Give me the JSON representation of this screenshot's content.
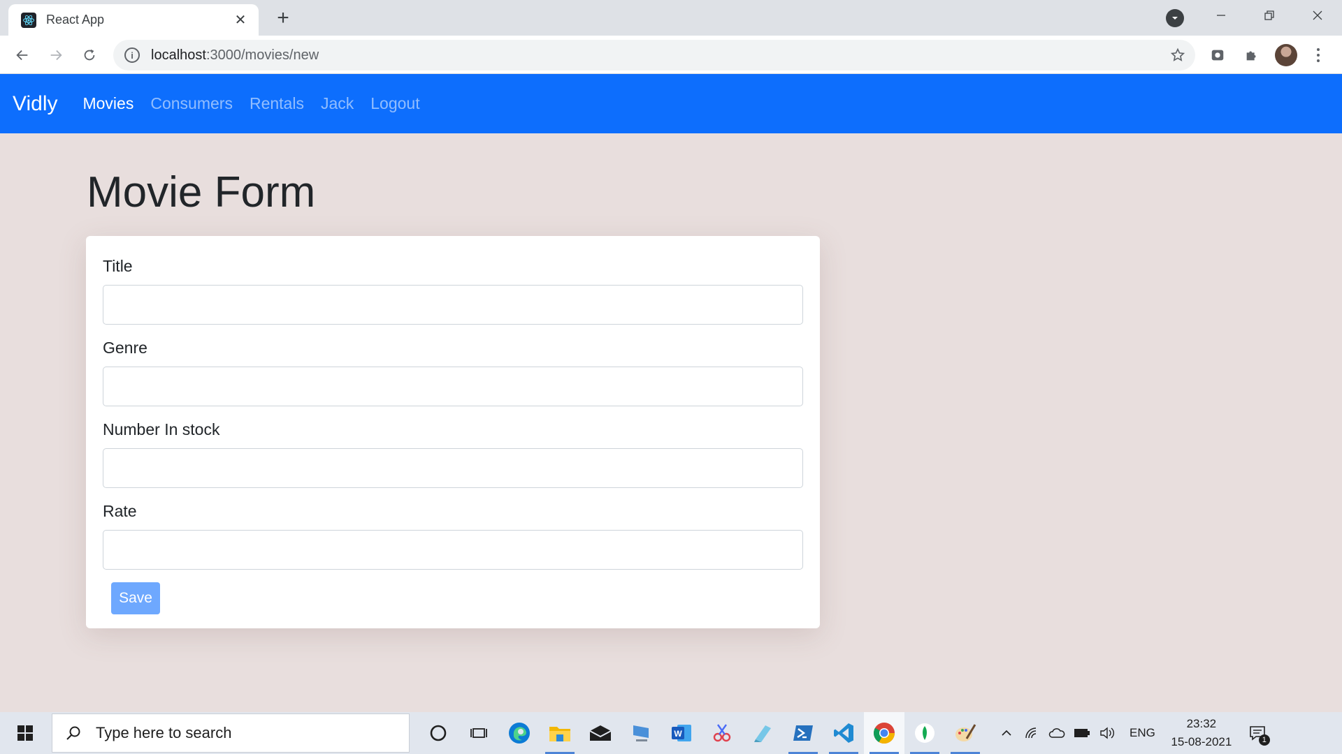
{
  "browser": {
    "tab_title": "React App",
    "url_host": "localhost",
    "url_path": ":3000/movies/new"
  },
  "navbar": {
    "brand": "Vidly",
    "links": [
      "Movies",
      "Consumers",
      "Rentals",
      "Jack",
      "Logout"
    ],
    "active": "Movies"
  },
  "page": {
    "title": "Movie Form",
    "fields": [
      {
        "label": "Title",
        "value": ""
      },
      {
        "label": "Genre",
        "value": ""
      },
      {
        "label": "Number In stock",
        "value": ""
      },
      {
        "label": "Rate",
        "value": ""
      }
    ],
    "save_label": "Save"
  },
  "colors": {
    "navbar_bg": "#0d6efd",
    "page_bg": "#e8dedd",
    "save_button_bg": "#6ea8fe"
  },
  "taskbar": {
    "search_placeholder": "Type here to search",
    "language": "ENG",
    "time": "23:32",
    "date": "15-08-2021",
    "notification_count": "1"
  }
}
